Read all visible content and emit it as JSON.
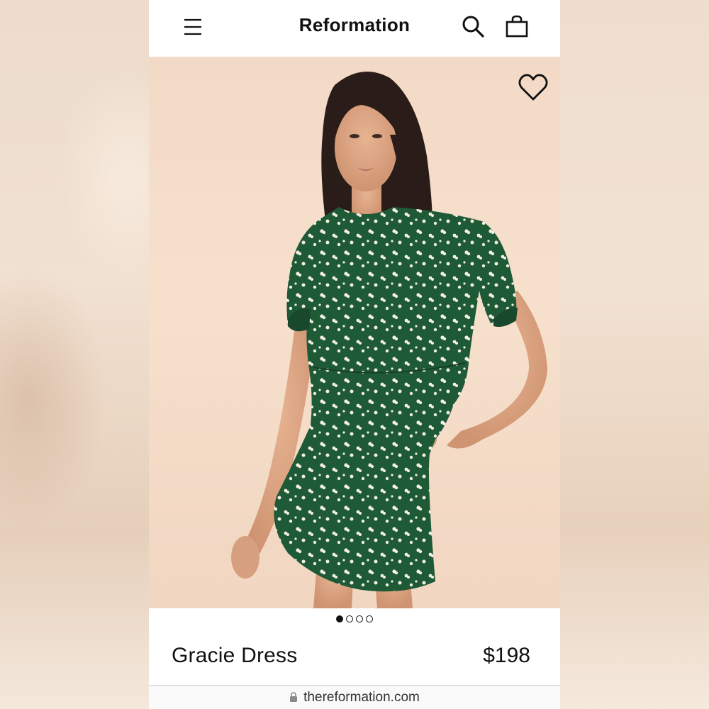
{
  "header": {
    "brand": "Reformation",
    "menu_icon": "hamburger-menu-icon",
    "search_icon": "search-icon",
    "bag_icon": "shopping-bag-icon"
  },
  "hero": {
    "wishlist_icon": "heart-outline-icon",
    "carousel": {
      "total": 4,
      "active": 1
    }
  },
  "product": {
    "name": "Gracie Dress",
    "price": "$198"
  },
  "browser": {
    "url": "thereformation.com",
    "lock_icon": "lock-icon"
  },
  "colors": {
    "background": "#f3e5d7",
    "hero_background": "#f3dac6",
    "dress_green": "#1f5a36",
    "text": "#111111"
  }
}
